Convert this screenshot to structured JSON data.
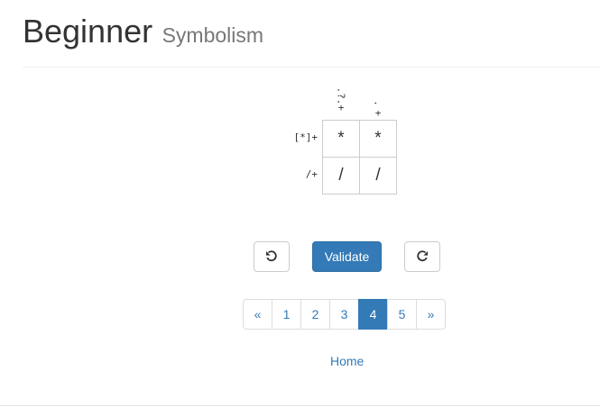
{
  "header": {
    "title": "Beginner",
    "subtitle": "Symbolism"
  },
  "puzzle": {
    "column_clues": [
      {
        "text": ".?.",
        "suffix": "+"
      },
      {
        "text": ".",
        "suffix": "+"
      }
    ],
    "row_clues": [
      "[*]+",
      "/+"
    ],
    "cells": [
      [
        "*",
        "*"
      ],
      [
        "/",
        "/"
      ]
    ]
  },
  "controls": {
    "undo_icon": "undo-icon",
    "validate_label": "Validate",
    "redo_icon": "redo-icon"
  },
  "pagination": {
    "prev": "«",
    "pages": [
      "1",
      "2",
      "3",
      "4",
      "5"
    ],
    "active_page": "4",
    "next": "»"
  },
  "footer": {
    "home_link": "Home"
  },
  "colors": {
    "primary": "#337ab7",
    "border": "#cccccc"
  }
}
